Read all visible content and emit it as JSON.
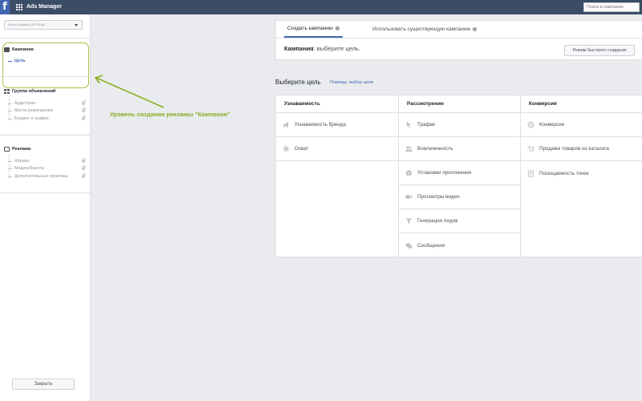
{
  "app": {
    "logo": "f",
    "title": "Ads Manager",
    "search_placeholder": "Поиск в кампании"
  },
  "sidebar": {
    "account_label": "Елена Гусева (10070148...",
    "campaign": {
      "title": "Кампания",
      "items": [
        "Цель"
      ]
    },
    "adset": {
      "title": "Группа объявлений",
      "items": [
        "Аудитория",
        "Места размещения",
        "Бюджет и график"
      ]
    },
    "ad": {
      "title": "Реклама",
      "items": [
        "Формат",
        "Медиаобъекты",
        "Дополнительные креативы"
      ]
    },
    "close_label": "Закрыть"
  },
  "annotation": "Уровень создания рекламы \"Кампания\"",
  "tabs": {
    "create": "Создать кампанию",
    "existing": "Использовать существующую кампанию",
    "info_glyph": "i"
  },
  "campaign_line": {
    "label": "Кампания",
    "text": ": выберите цель."
  },
  "quick_create": "Режим быстрого создания",
  "objective": {
    "title": "Выберите цель",
    "help": "Помощь: выбор цели",
    "columns": [
      {
        "header": "Узнаваемость",
        "items": [
          {
            "label": "Узнаваемость бренда",
            "icon": "megaphone-icon"
          },
          {
            "label": "Охват",
            "icon": "snowflake-icon"
          }
        ]
      },
      {
        "header": "Рассмотрение",
        "items": [
          {
            "label": "Трафик",
            "icon": "cursor-icon"
          },
          {
            "label": "Вовлеченность",
            "icon": "people-icon"
          },
          {
            "label": "Установки приложения",
            "icon": "box-icon"
          },
          {
            "label": "Просмотры видео",
            "icon": "video-icon"
          },
          {
            "label": "Генерация лидов",
            "icon": "funnel-icon"
          },
          {
            "label": "Сообщения",
            "icon": "chat-icon"
          }
        ]
      },
      {
        "header": "Конверсия",
        "items": [
          {
            "label": "Конверсии",
            "icon": "globe-icon"
          },
          {
            "label": "Продажи товаров из каталога",
            "icon": "cart-icon"
          },
          {
            "label": "Посещаемость точек",
            "icon": "store-icon"
          }
        ]
      }
    ]
  },
  "colors": {
    "accent": "#4267b2",
    "annotation": "#8cac24",
    "topbar": "#3b4d66"
  }
}
